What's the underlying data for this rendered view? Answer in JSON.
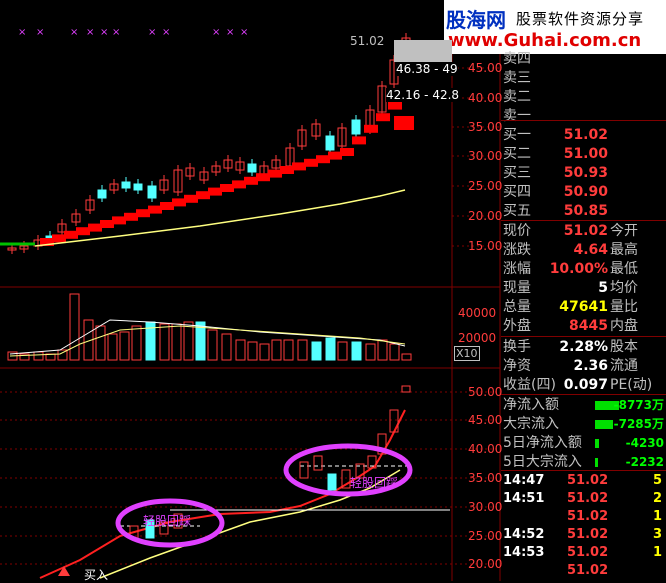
{
  "header": {
    "logo_text": "股海网",
    "slogan": "股票软件资源分享",
    "url": "www.Guhai.com.cn"
  },
  "colors": {
    "up": "#ff3c3c",
    "down": "#54ffff",
    "label": "#c0c0c0",
    "white": "#ffffff",
    "grid": "#800000",
    "yellow_line": "#ffff80",
    "highlight_circle": "#e040ff",
    "logo_red": "#e00000",
    "logo_blue": "#0030c0"
  },
  "price_chart": {
    "price_marker": "51.02",
    "price_axis": [
      "45.00",
      "40.00",
      "35.00",
      "30.00",
      "25.00",
      "20.00",
      "15.00"
    ],
    "overlay_labels": [
      "46.38 - 49",
      "42.16 - 42.8"
    ]
  },
  "volume_chart": {
    "axis": [
      "40000",
      "20000"
    ],
    "unit": "X10"
  },
  "indicator_chart": {
    "axis": [
      "50.00",
      "45.00",
      "40.00",
      "35.00",
      "30.00",
      "25.00",
      "20.00"
    ],
    "annotations": [
      "轻股回踩",
      "轻股回踩"
    ],
    "buy_label": "买入"
  },
  "order_book": {
    "sells": [
      {
        "label": "卖四"
      },
      {
        "label": "卖三"
      },
      {
        "label": "卖二"
      },
      {
        "label": "卖一"
      }
    ],
    "buys": [
      {
        "label": "买一",
        "price": "51.02"
      },
      {
        "label": "买二",
        "price": "51.00"
      },
      {
        "label": "买三",
        "price": "50.93"
      },
      {
        "label": "买四",
        "price": "50.90"
      },
      {
        "label": "买五",
        "price": "50.85"
      }
    ]
  },
  "quote": [
    {
      "label": "现价",
      "value": "51.02",
      "color": "up",
      "label2": "今开"
    },
    {
      "label": "涨跌",
      "value": "4.64",
      "color": "up",
      "label2": "最高"
    },
    {
      "label": "涨幅",
      "value": "10.00%",
      "color": "up",
      "label2": "最低"
    },
    {
      "label": "现量",
      "value": "5",
      "color": "white",
      "label2": "均价"
    },
    {
      "label": "总量",
      "value": "47641",
      "color": "yellow",
      "label2": "量比"
    },
    {
      "label": "外盘",
      "value": "8445",
      "color": "up",
      "label2": "内盘"
    }
  ],
  "stats": [
    {
      "label": "换手",
      "value": "2.28%",
      "label2": "股本"
    },
    {
      "label": "净资",
      "value": "2.36",
      "label2": "流通"
    },
    {
      "label": "收益(四)",
      "value": "0.097",
      "label2": "PE(动)"
    }
  ],
  "flows": [
    {
      "label": "净流入额",
      "value": "-8773万"
    },
    {
      "label": "大宗流入",
      "value": "-7285万"
    },
    {
      "label": "5日净流入额",
      "value": "-4230"
    },
    {
      "label": "5日大宗流入",
      "value": "-2232"
    }
  ],
  "trades": [
    {
      "time": "14:47",
      "price": "51.02",
      "vol": "5"
    },
    {
      "time": "14:51",
      "price": "51.02",
      "vol": "2"
    },
    {
      "time": "",
      "price": "51.02",
      "vol": "1"
    },
    {
      "time": "14:52",
      "price": "51.02",
      "vol": "3"
    },
    {
      "time": "14:53",
      "price": "51.02",
      "vol": "1"
    },
    {
      "time": "",
      "price": "51.02",
      "vol": ""
    }
  ]
}
